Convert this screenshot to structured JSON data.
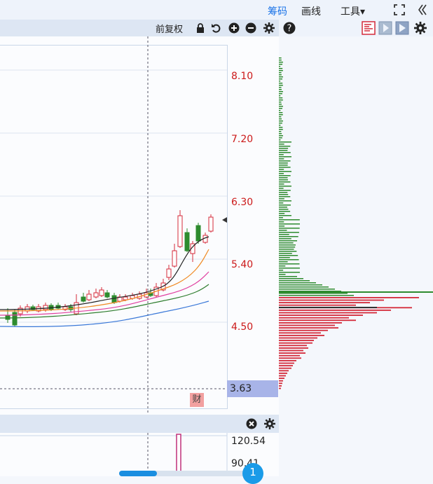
{
  "topbar": {
    "chips_label": "筹码",
    "draw_label": "画线",
    "tools_label": "工具▾",
    "accent": "#1a73e8"
  },
  "toolbar": {
    "adjust_label": "前复权"
  },
  "axis": {
    "labels": [
      "8.10",
      "7.20",
      "6.30",
      "5.40",
      "4.50"
    ],
    "current_price": "3.63"
  },
  "finance_marker": "财",
  "volume": {
    "labels": [
      "120.54",
      "90.41"
    ]
  },
  "page_indicator": "1",
  "colors": {
    "up": "#d42a3a",
    "down": "#2e8b2e",
    "ma5": "#222222",
    "ma10": "#f08a24",
    "ma20": "#e040a0",
    "ma30": "#2e7d2e",
    "ma60": "#3a78d8"
  }
}
